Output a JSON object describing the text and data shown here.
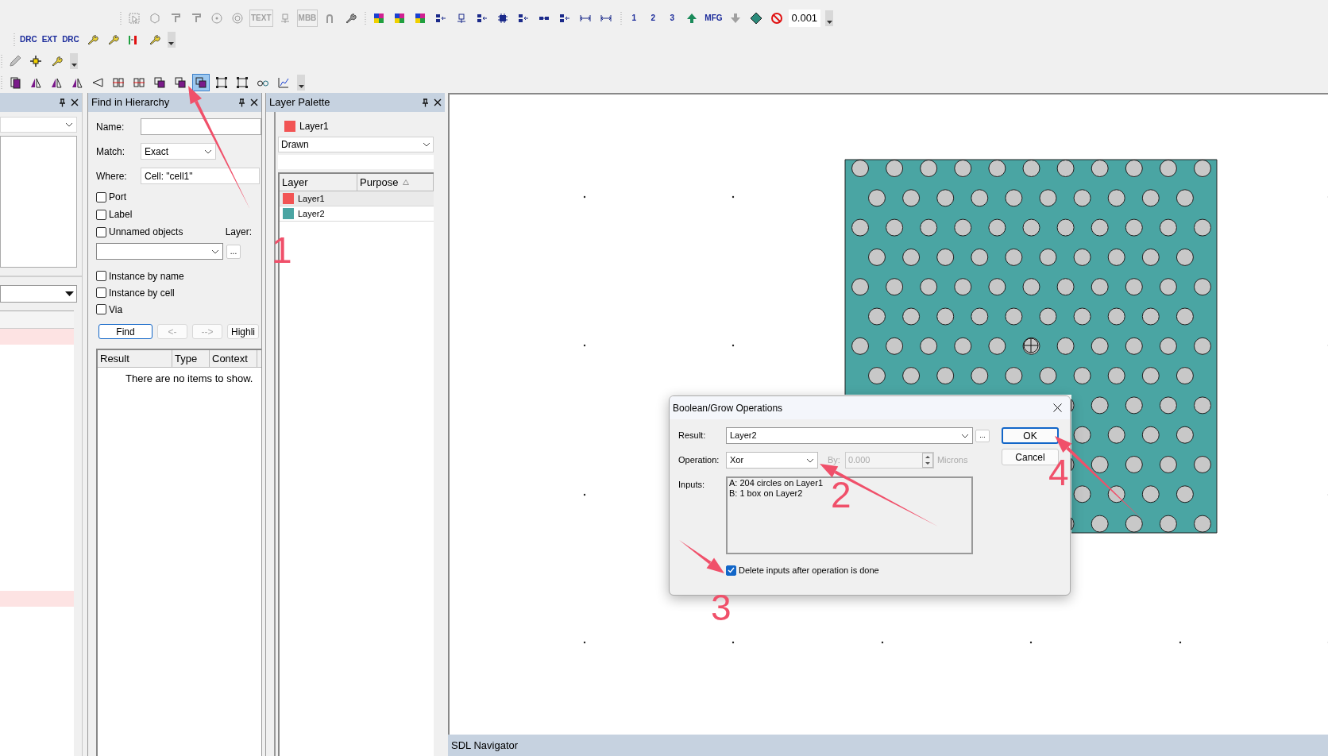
{
  "toolbars": [
    {
      "groups": [
        {
          "disabled": true,
          "items": [
            {
              "kind": "icon"
            },
            {
              "kind": "icon"
            },
            {
              "kind": "icon"
            },
            {
              "kind": "icon"
            },
            {
              "kind": "icon"
            },
            {
              "kind": "icon"
            },
            {
              "kind": "text-icon",
              "label": "TEXT"
            },
            {
              "kind": "icon"
            },
            {
              "kind": "text-icon",
              "label": "MBB"
            },
            {
              "kind": "icon"
            },
            {
              "kind": "icon"
            }
          ]
        },
        {
          "disabled": false,
          "items": [
            {
              "kind": "icon"
            },
            {
              "kind": "icon"
            },
            {
              "kind": "icon"
            },
            {
              "kind": "icon"
            },
            {
              "kind": "icon"
            },
            {
              "kind": "icon"
            },
            {
              "kind": "icon"
            },
            {
              "kind": "icon"
            },
            {
              "kind": "icon"
            },
            {
              "kind": "icon"
            },
            {
              "kind": "icon"
            },
            {
              "kind": "icon"
            }
          ]
        },
        {
          "disabled": false,
          "items": [
            {
              "kind": "text-icon",
              "label": "1"
            },
            {
              "kind": "text-icon",
              "label": "2"
            },
            {
              "kind": "text-icon",
              "label": "3"
            },
            {
              "kind": "icon"
            },
            {
              "kind": "text-icon",
              "label": "MFG"
            },
            {
              "kind": "icon"
            },
            {
              "kind": "icon"
            },
            {
              "kind": "icon"
            },
            {
              "kind": "field",
              "value": "0.001"
            }
          ]
        }
      ]
    },
    {
      "groups": [
        {
          "disabled": false,
          "items": [
            {
              "kind": "text-icon",
              "label": "DRC"
            },
            {
              "kind": "text-icon",
              "label": "EXT"
            },
            {
              "kind": "text-icon",
              "label": "DRC"
            },
            {
              "kind": "icon"
            },
            {
              "kind": "icon"
            },
            {
              "kind": "icon"
            },
            {
              "kind": "icon"
            }
          ]
        }
      ]
    },
    {
      "groups": [
        {
          "disabled": false,
          "items": [
            {
              "kind": "icon"
            },
            {
              "kind": "icon"
            },
            {
              "kind": "icon"
            }
          ]
        }
      ]
    },
    {
      "groups": [
        {
          "disabled": false,
          "items": [
            {
              "kind": "icon",
              "pressed": false
            },
            {
              "kind": "icon",
              "pressed": false
            },
            {
              "kind": "icon",
              "pressed": false
            },
            {
              "kind": "icon",
              "pressed": false
            },
            {
              "kind": "icon",
              "pressed": false
            },
            {
              "kind": "icon",
              "pressed": false
            },
            {
              "kind": "icon",
              "pressed": false
            },
            {
              "kind": "icon",
              "pressed": false
            },
            {
              "kind": "icon",
              "pressed": false
            },
            {
              "kind": "icon",
              "pressed": true
            },
            {
              "kind": "icon",
              "pressed": false
            },
            {
              "kind": "icon",
              "pressed": false
            },
            {
              "kind": "icon",
              "pressed": false
            },
            {
              "kind": "icon",
              "pressed": false
            }
          ]
        }
      ]
    }
  ],
  "find_in_hierarchy": {
    "title": "Find in Hierarchy",
    "name": {
      "label": "Name:"
    },
    "match": {
      "label": "Match:",
      "value": "Exact"
    },
    "where": {
      "label": "Where:",
      "value": "Cell: \"cell1\""
    },
    "checkboxes": [
      {
        "label": "Port",
        "checked": false
      },
      {
        "label": "Label",
        "checked": false
      },
      {
        "label": "Unnamed objects",
        "checked": false
      }
    ],
    "layer_label": "Layer:",
    "layer_browse": "...",
    "checkboxes_2": [
      {
        "label": "Instance by name",
        "checked": false
      },
      {
        "label": "Instance by cell",
        "checked": false
      },
      {
        "label": "Via",
        "checked": false
      }
    ],
    "buttons": [
      {
        "label": "Find",
        "disabled": false,
        "default": true
      },
      {
        "label": "<-",
        "disabled": true,
        "default": false
      },
      {
        "label": "-->",
        "disabled": true,
        "default": false
      },
      {
        "label": "Highli",
        "disabled": false,
        "default": false
      }
    ],
    "results": {
      "columns": [
        "Result",
        "Type",
        "Context"
      ],
      "empty_message": "There are no items to show."
    }
  },
  "layer_palette": {
    "title": "Layer Palette",
    "current_layer": {
      "name": "Layer1",
      "color": "#f25454"
    },
    "purpose": "Drawn",
    "columns": [
      "Layer",
      "Purpose"
    ],
    "rows": [
      {
        "name": "Layer1",
        "color": "#f25454",
        "selected": true
      },
      {
        "name": "Layer2",
        "color": "#4aa5a3",
        "selected": false
      }
    ]
  },
  "navigator": {
    "title": "SDL Navigator"
  },
  "dialog": {
    "title": "Boolean/Grow Operations",
    "result": {
      "label": "Result:",
      "value": "Layer2"
    },
    "browse": "...",
    "operation": {
      "label": "Operation:",
      "value": "Xor"
    },
    "by": {
      "label": "By:",
      "value": "0.000",
      "unit": "Microns",
      "disabled": true
    },
    "inputs": {
      "label": "Inputs:",
      "lines": [
        "A: 204 circles on Layer1",
        "B: 1 box on Layer2"
      ]
    },
    "delete_inputs": {
      "label": "Delete inputs after operation is done",
      "checked": true
    },
    "buttons": [
      {
        "label": "OK",
        "default": true
      },
      {
        "label": "Cancel",
        "default": false
      }
    ]
  },
  "annotations": [
    {
      "label": "1"
    },
    {
      "label": "2"
    },
    {
      "label": "3"
    },
    {
      "label": "4"
    }
  ]
}
